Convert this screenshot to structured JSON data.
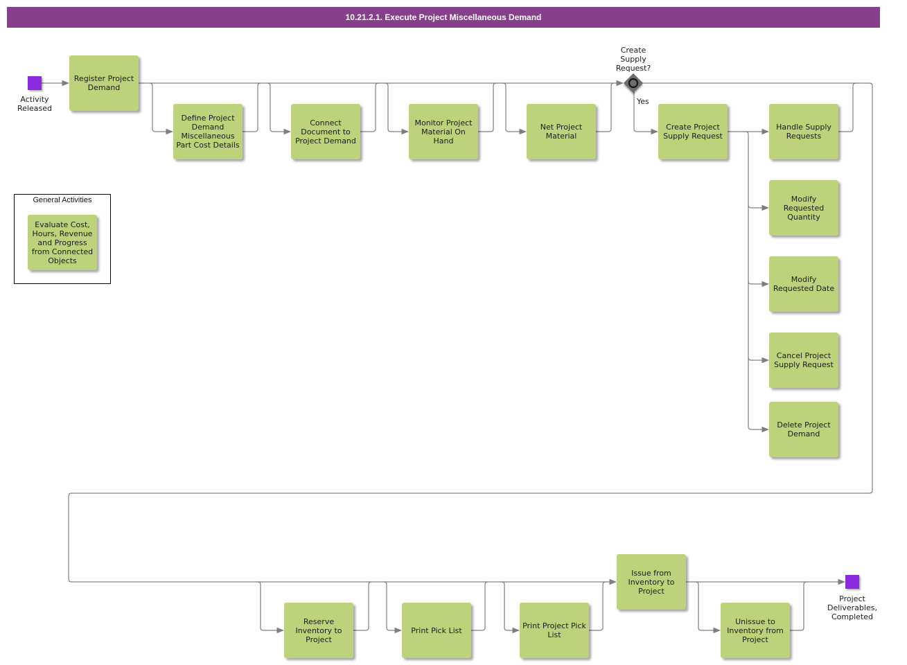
{
  "title": "10.21.2.1. Execute Project Miscellaneous Demand",
  "colors": {
    "title_bar": "#86408b",
    "task_fill": "#bdd37b",
    "event_fill": "#8a2be2",
    "gateway_fill": "#6d6d6d",
    "connector": "#7f7f7f"
  },
  "events": {
    "start": "Activity\nReleased",
    "end": "Project\nDeliverables,\nCompleted"
  },
  "gateway": {
    "question": "Create\nSupply\nRequest?",
    "yes_label": "Yes"
  },
  "tasks": {
    "register_project_demand": "Register Project Demand",
    "define_misc_part_cost": "Define Project Demand Miscellaneous Part Cost Details",
    "connect_document": "Connect Document to Project Demand",
    "monitor_material": "Monitor Project Material On Hand",
    "net_project_material": "Net Project Material",
    "create_supply_request": "Create Project Supply Request",
    "handle_supply_requests": "Handle Supply Requests",
    "modify_requested_quantity": "Modify Requested Quantity",
    "modify_requested_date": "Modify Requested Date",
    "cancel_supply_request": "Cancel Project Supply Request",
    "delete_project_demand": "Delete Project Demand",
    "reserve_inventory": "Reserve Inventory to Project",
    "print_pick_list": "Print Pick List",
    "print_project_pick_list": "Print Project Pick List",
    "issue_from_inventory": "Issue from Inventory to Project",
    "unissue_to_inventory": "Unissue to Inventory from Project"
  },
  "general_activities": {
    "title": "General Activities",
    "items": [
      "Evaluate Cost, Hours, Revenue and Progress from Connected Objects"
    ]
  }
}
